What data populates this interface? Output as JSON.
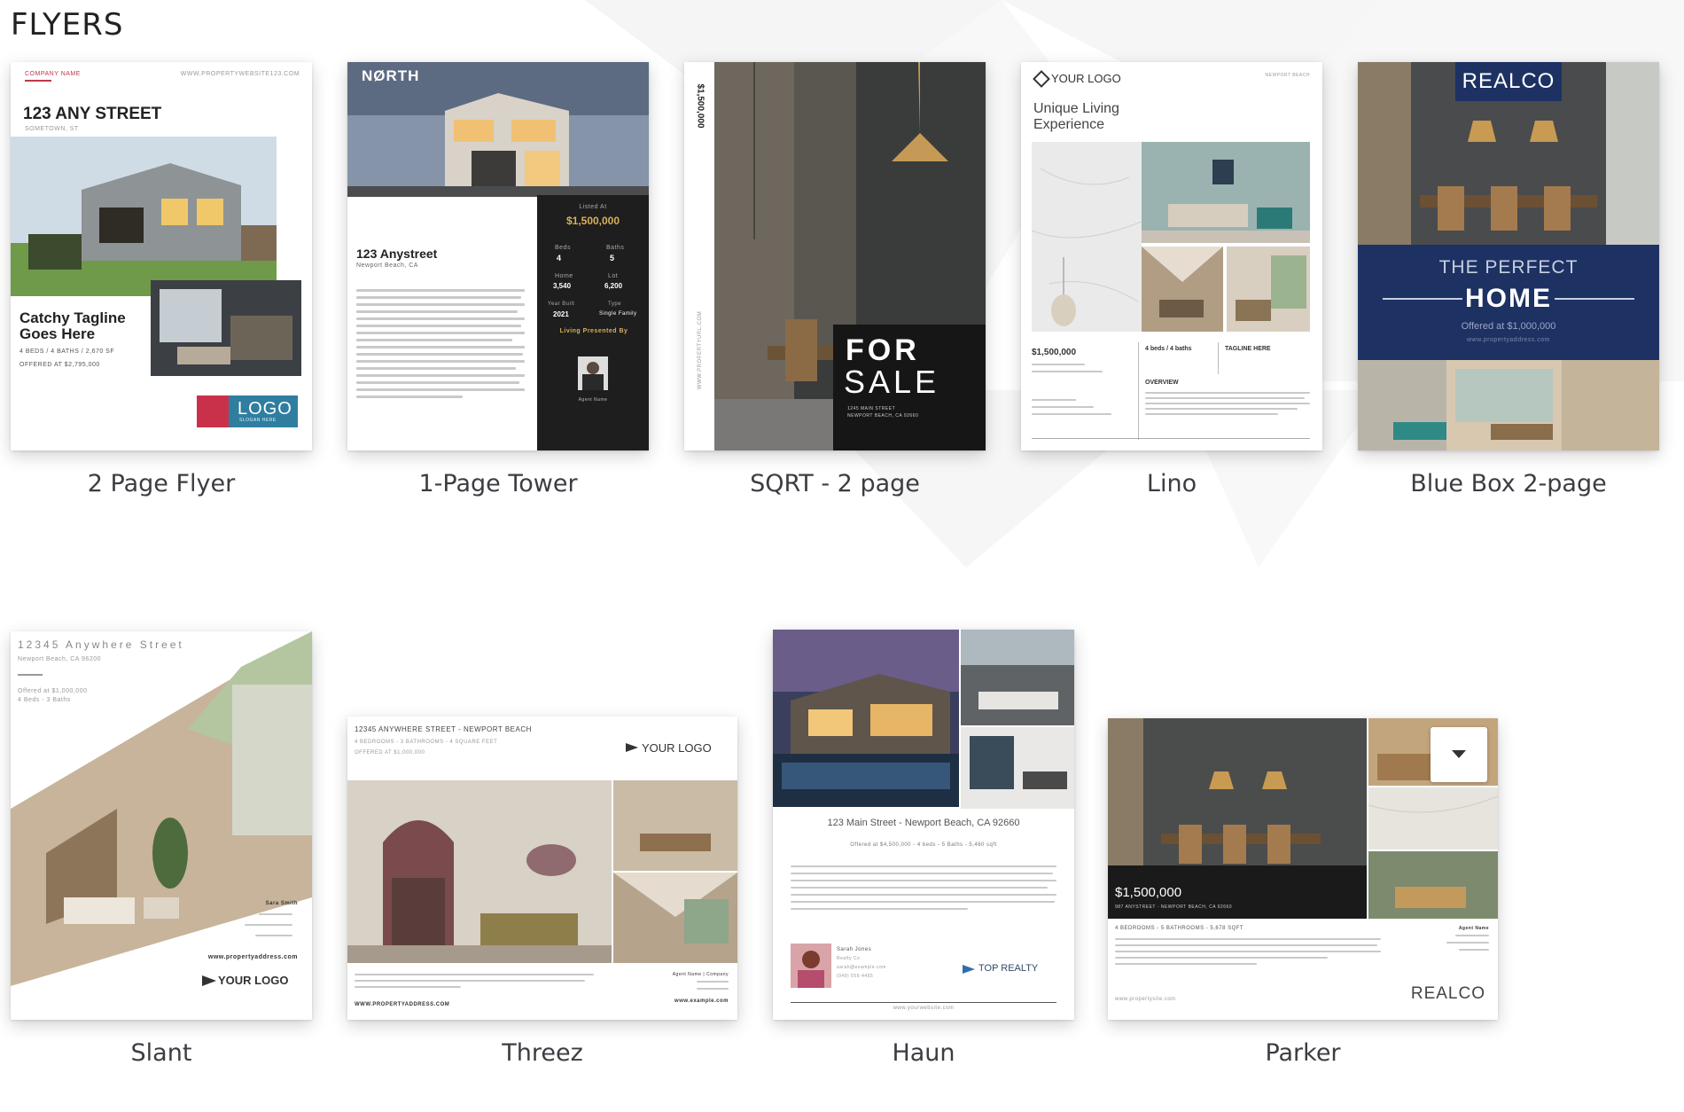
{
  "section_title": "FLYERS",
  "templates": [
    {
      "label": "2 Page Flyer",
      "company": "COMPANY NAME",
      "website": "WWW.PROPERTYWEBSITE123.COM",
      "address": "123 ANY STREET",
      "city": "SOMETOWN, ST",
      "tagline": "Catchy Tagline Goes Here",
      "specs": "4 BEDS / 4 BATHS / 2,670 SF",
      "offered": "OFFERED AT $2,795,000",
      "logo": "LOGO",
      "logo_sub": "SLOGAN HERE"
    },
    {
      "label": "1-Page Tower",
      "brand": "NØRTH",
      "listed_at": "Listed At",
      "price": "$1,500,000",
      "address": "123 Anystreet",
      "city": "Newport Beach, CA",
      "beds_label": "Beds",
      "beds": "4",
      "baths_label": "Baths",
      "baths": "5",
      "home_label": "Home",
      "home": "3,540",
      "lot_label": "Lot",
      "lot": "6,200",
      "year_label": "Year Built",
      "year": "2021",
      "type_label": "Type",
      "type": "Single Family",
      "presented_by": "Living Presented By",
      "agent": "Agent Name"
    },
    {
      "label": "SQRT - 2 page",
      "price": "$1,500,000",
      "url": "WWW.PROPERTYURL.COM",
      "headline_1": "FOR",
      "headline_2": "SALE",
      "address": "1245 MAIN STREET",
      "city": "NEWPORT BEACH, CA 92660"
    },
    {
      "label": "Lino",
      "logo": "YOUR LOGO",
      "location": "NEWPORT BEACH",
      "headline": "Unique Living Experience",
      "price": "$1,500,000",
      "beds": "4 beds / 4 baths",
      "tagline": "TAGLINE HERE",
      "overview": "OVERVIEW"
    },
    {
      "label": "Blue Box 2-page",
      "brand": "REALCO",
      "line1": "THE PERFECT",
      "line2": "HOME",
      "offered": "Offered at $1,000,000",
      "url": "www.propertyaddress.com"
    },
    {
      "label": "Slant",
      "address": "12345 Anywhere Street",
      "city": "Newport Beach, CA 96200",
      "offered": "Offered at $1,000,000",
      "beds": "4 Beds - 3 Baths",
      "agent": "Sara Smith",
      "url": "www.propertyaddress.com",
      "logo": "YOUR LOGO"
    },
    {
      "label": "Threez",
      "address": "12345 ANYWHERE STREET - NEWPORT BEACH",
      "specs": "4 BEDROOMS - 3 BATHROOMS - 4 SQUARE FEET",
      "offered": "OFFERED AT $1,000,000",
      "logo": "YOUR LOGO",
      "url": "WWW.PROPERTYADDRESS.COM",
      "agent": "Agent Name | Company",
      "site": "www.example.com"
    },
    {
      "label": "Haun",
      "address": "123 Main Street - Newport Beach, CA 92660",
      "specs": "Offered at $4,500,000 - 4 beds - 5 Baths - 5,460 sqft",
      "agent": "Sarah Jones",
      "company": "Realty Co",
      "email": "sarah@example.com",
      "phone": "(949) 555-4455",
      "brand": "TOP REALTY",
      "url": "www.yourwebsite.com"
    },
    {
      "label": "Parker",
      "price": "$1,500,000",
      "address": "987 ANYSTREET - NEWPORT BEACH, CA 92660",
      "specs": "4 BEDROOMS - 5 BATHROOMS - 5,678 SQFT",
      "agent": "Agent Name",
      "url": "www.propertysite.com",
      "brand": "REALCO"
    }
  ]
}
